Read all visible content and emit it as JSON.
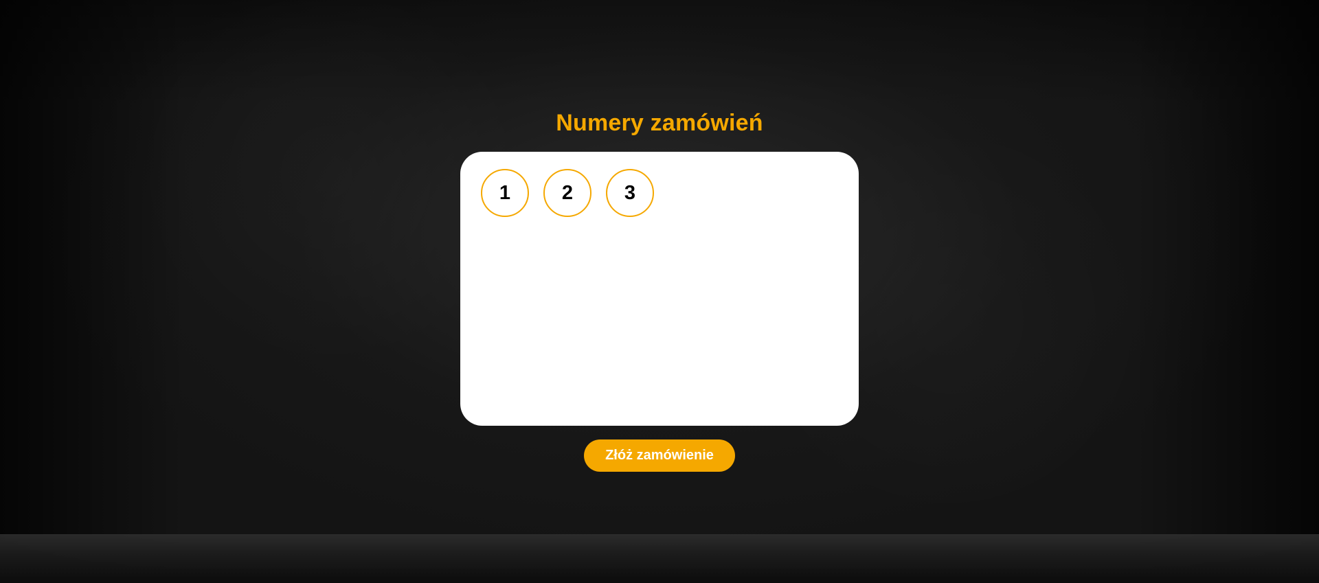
{
  "page": {
    "title": "Numery zamówień"
  },
  "orders": [
    {
      "number": "1"
    },
    {
      "number": "2"
    },
    {
      "number": "3"
    }
  ],
  "actions": {
    "submit_label": "Złóż zamówienie"
  },
  "colors": {
    "accent": "#f5a800",
    "panel": "#ffffff",
    "background": "#141414",
    "badge_text": "#000000",
    "button_text": "#ffffff"
  }
}
